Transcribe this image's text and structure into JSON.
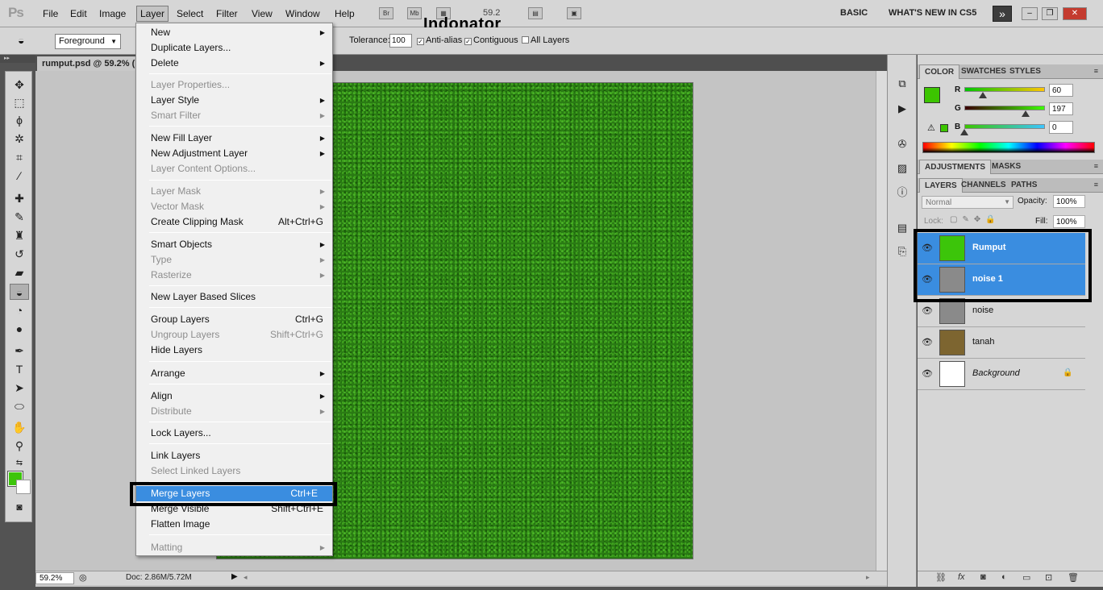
{
  "app": {
    "logo": "Ps",
    "watermark": "Indonator",
    "zoom_display": "59.2"
  },
  "menubar": {
    "items": [
      "File",
      "Edit",
      "Image",
      "Layer",
      "Select",
      "Filter",
      "View",
      "Window",
      "Help"
    ],
    "bridge": "Br",
    "minibridge": "Mb",
    "workspaces": [
      "BASIC",
      "WHAT'S NEW IN CS5"
    ]
  },
  "options": {
    "fill_source": "Foreground",
    "tolerance_label": "Tolerance:",
    "tolerance": "100",
    "antialias": "Anti-alias",
    "contiguous": "Contiguous",
    "all_layers": "All Layers"
  },
  "document": {
    "tab_title": "rumput.psd @ 59.2% (",
    "status_zoom": "59.2%",
    "status_doc": "Doc: 2.86M/5.72M"
  },
  "layer_menu": {
    "items": [
      {
        "label": "New",
        "shortcut": "",
        "sub": true,
        "disabled": false
      },
      {
        "label": "Duplicate Layers...",
        "shortcut": "",
        "sub": false,
        "disabled": false
      },
      {
        "label": "Delete",
        "shortcut": "",
        "sub": true,
        "disabled": false
      },
      {
        "label": "Layer Properties...",
        "shortcut": "",
        "sub": false,
        "disabled": true
      },
      {
        "label": "Layer Style",
        "shortcut": "",
        "sub": true,
        "disabled": false
      },
      {
        "label": "Smart Filter",
        "shortcut": "",
        "sub": true,
        "disabled": true
      },
      {
        "label": "New Fill Layer",
        "shortcut": "",
        "sub": true,
        "disabled": false
      },
      {
        "label": "New Adjustment Layer",
        "shortcut": "",
        "sub": true,
        "disabled": false
      },
      {
        "label": "Layer Content Options...",
        "shortcut": "",
        "sub": false,
        "disabled": true
      },
      {
        "label": "Layer Mask",
        "shortcut": "",
        "sub": true,
        "disabled": true
      },
      {
        "label": "Vector Mask",
        "shortcut": "",
        "sub": true,
        "disabled": true
      },
      {
        "label": "Create Clipping Mask",
        "shortcut": "Alt+Ctrl+G",
        "sub": false,
        "disabled": false
      },
      {
        "label": "Smart Objects",
        "shortcut": "",
        "sub": true,
        "disabled": false
      },
      {
        "label": "Type",
        "shortcut": "",
        "sub": true,
        "disabled": true
      },
      {
        "label": "Rasterize",
        "shortcut": "",
        "sub": true,
        "disabled": true
      },
      {
        "label": "New Layer Based Slices",
        "shortcut": "",
        "sub": false,
        "disabled": false
      },
      {
        "label": "Group Layers",
        "shortcut": "Ctrl+G",
        "sub": false,
        "disabled": false
      },
      {
        "label": "Ungroup Layers",
        "shortcut": "Shift+Ctrl+G",
        "sub": false,
        "disabled": true
      },
      {
        "label": "Hide Layers",
        "shortcut": "",
        "sub": false,
        "disabled": false
      },
      {
        "label": "Arrange",
        "shortcut": "",
        "sub": true,
        "disabled": false
      },
      {
        "label": "Align",
        "shortcut": "",
        "sub": true,
        "disabled": false
      },
      {
        "label": "Distribute",
        "shortcut": "",
        "sub": true,
        "disabled": true
      },
      {
        "label": "Lock Layers...",
        "shortcut": "",
        "sub": false,
        "disabled": false
      },
      {
        "label": "Link Layers",
        "shortcut": "",
        "sub": false,
        "disabled": false
      },
      {
        "label": "Select Linked Layers",
        "shortcut": "",
        "sub": false,
        "disabled": true
      },
      {
        "label": "Merge Layers",
        "shortcut": "Ctrl+E",
        "sub": false,
        "disabled": false,
        "highlighted": true
      },
      {
        "label": "Merge Visible",
        "shortcut": "Shift+Ctrl+E",
        "sub": false,
        "disabled": false
      },
      {
        "label": "Flatten Image",
        "shortcut": "",
        "sub": false,
        "disabled": false
      },
      {
        "label": "Matting",
        "shortcut": "",
        "sub": true,
        "disabled": true
      }
    ]
  },
  "color_panel": {
    "tabs": [
      "COLOR",
      "SWATCHES",
      "STYLES"
    ],
    "r_label": "R",
    "g_label": "G",
    "b_label": "B",
    "r": "60",
    "g": "197",
    "b": "0",
    "foreground": "#3cc500"
  },
  "adjust_panel": {
    "tabs": [
      "ADJUSTMENTS",
      "MASKS"
    ]
  },
  "layers_panel": {
    "tabs": [
      "LAYERS",
      "CHANNELS",
      "PATHS"
    ],
    "blend_mode": "Normal",
    "opacity_label": "Opacity:",
    "opacity": "100%",
    "lock_label": "Lock:",
    "fill_label": "Fill:",
    "fill": "100%",
    "layers": [
      {
        "name": "Rumput",
        "selected": true,
        "thumb": "#3cc50a"
      },
      {
        "name": "noise 1",
        "selected": true,
        "thumb": "#8a8a8a"
      },
      {
        "name": "noise",
        "selected": false,
        "thumb": "#8a8a8a"
      },
      {
        "name": "tanah",
        "selected": false,
        "thumb": "#7d6530"
      },
      {
        "name": "Background",
        "selected": false,
        "thumb": "#ffffff"
      }
    ]
  }
}
